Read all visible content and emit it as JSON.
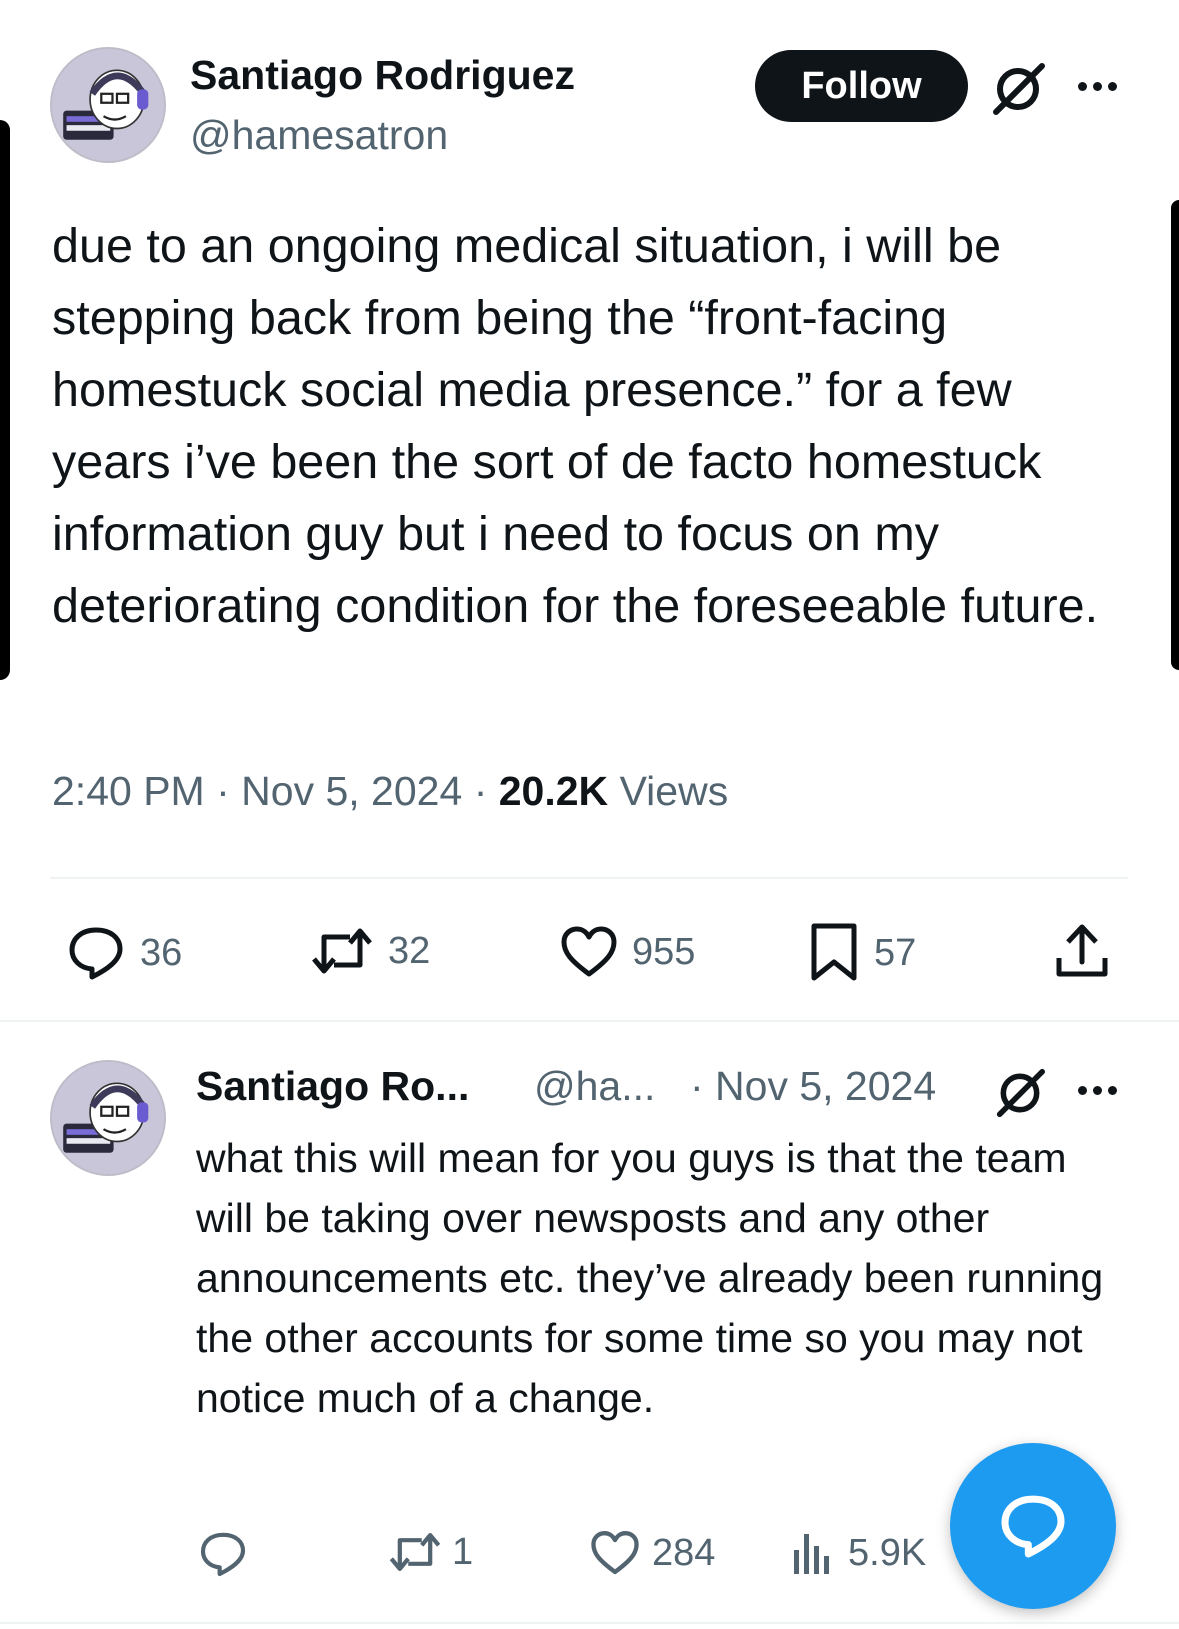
{
  "main_tweet": {
    "author_name": "Santiago Rodriguez",
    "author_handle": "@hamesatron",
    "follow_label": "Follow",
    "text": "due to an ongoing medical situation, i will be stepping back from being the “front-facing homestuck social media presence.” for a few years i’ve been the sort of de facto homestuck information guy but i need to focus on my deteriorating condition for the foreseeable future.",
    "time": "2:40 PM",
    "separator": "·",
    "date": "Nov 5, 2024",
    "views_count": "20.2K",
    "views_label": "Views",
    "replies": "36",
    "reposts": "32",
    "likes": "955",
    "bookmarks": "57"
  },
  "reply_tweet": {
    "author_name": "Santiago Ro...",
    "author_handle": "@ha...",
    "date": "· Nov 5, 2024",
    "text": "what this will mean for you guys is that the team will be taking over newsposts and any other announcements etc. they’ve already been running the other accounts for some time so you may not notice much of a change.",
    "replies": "",
    "reposts": "1",
    "likes": "284",
    "views": "5.9K"
  },
  "icons": {
    "avatar": "avatar-headphones-character",
    "grok": "grok-icon",
    "more": "more-icon",
    "reply": "reply-icon",
    "repost": "repost-icon",
    "like": "heart-icon",
    "bookmark": "bookmark-icon",
    "share": "share-icon",
    "views": "views-icon",
    "compose": "compose-reply-icon"
  },
  "colors": {
    "accent": "#1d9bf0",
    "text": "#0f1419",
    "secondary": "#536471"
  }
}
